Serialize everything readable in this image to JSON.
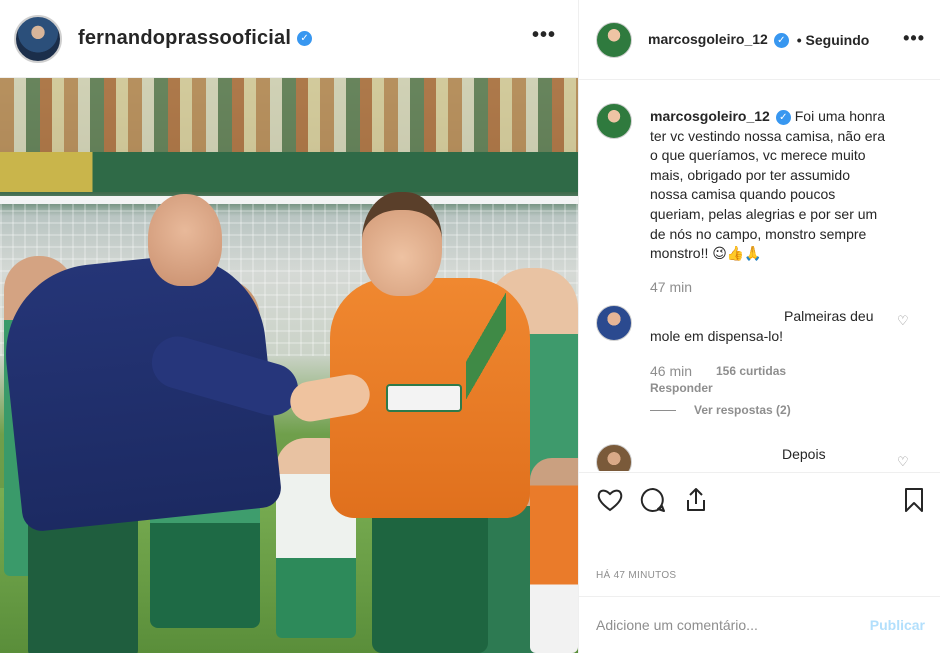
{
  "post": {
    "author": "fernandoprassooficial",
    "more_label": "•••"
  },
  "panel": {
    "author": "marcosgoleiro_12",
    "separator": "•",
    "following": "Seguindo",
    "more_label": "•••"
  },
  "caption": {
    "user": "marcosgoleiro_12",
    "text": "Foi uma honra ter vc vestindo nossa camisa, não era o que queríamos, vc merece muito mais, obrigado por ter assumido nossa camisa quando poucos queriam, pelas alegrias e por ser um de nós no campo, monstro sempre monstro!! 😉👍🙏",
    "time": "47 min"
  },
  "comments": [
    {
      "line1": "Palmeiras deu",
      "line2": "mole em dispensa-lo!",
      "time": "46 min",
      "likes": "156 curtidas",
      "reply_label": "Responder",
      "replies_label": "Ver respostas (2)"
    },
    {
      "text": "Depois"
    }
  ],
  "meta": {
    "time_ago": "HÁ 47 MINUTOS"
  },
  "composer": {
    "placeholder": "Adicione um comentário...",
    "publish_label": "Publicar"
  },
  "colors": {
    "verified": "#3897f0",
    "publish_disabled": "#b2dffc",
    "muted": "#8e8e8e"
  },
  "icons": [
    "verified-icon",
    "heart-icon",
    "comment-icon",
    "share-icon",
    "bookmark-icon"
  ]
}
